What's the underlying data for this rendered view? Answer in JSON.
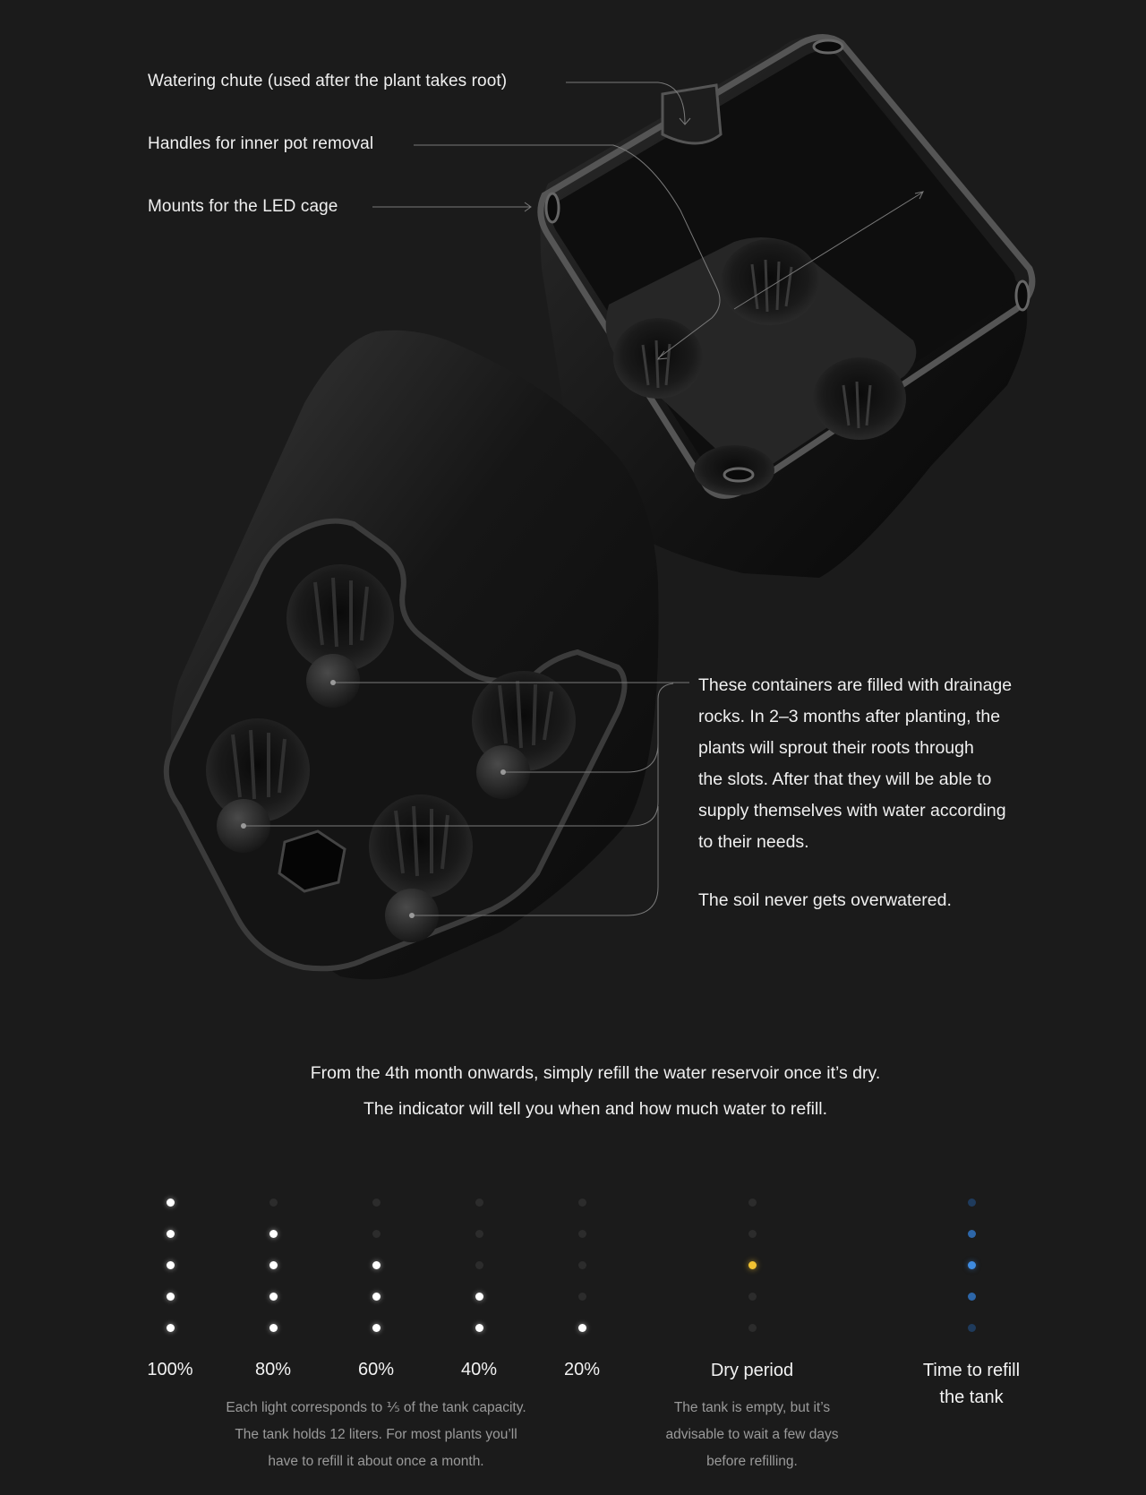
{
  "callouts": {
    "watering_chute": "Watering chute (used after the plant takes root)",
    "handles": "Handles for inner pot removal",
    "mounts": "Mounts for the LED cage"
  },
  "drainage": {
    "paragraph1_lines": [
      "These containers are filled with drainage",
      "rocks. In 2–3 months after planting, the",
      "plants will sprout their roots through",
      "the slots. After that they will be able to",
      "supply themselves with water according",
      "to their needs."
    ],
    "paragraph2": "The soil never gets overwatered."
  },
  "indicator_intro": {
    "line1": "From the 4th month onwards, simply refill the water reservoir once it’s dry.",
    "line2": "The indicator will tell you when and how much water to refill."
  },
  "levels": [
    {
      "label": "100%",
      "lit": 5
    },
    {
      "label": "80%",
      "lit": 4
    },
    {
      "label": "60%",
      "lit": 3
    },
    {
      "label": "40%",
      "lit": 2
    },
    {
      "label": "20%",
      "lit": 1
    }
  ],
  "level_note_lines": [
    "Each light corresponds to ⅕ of the tank capacity.",
    "The tank holds 12 liters. For most plants you’ll",
    "have to refill it about once a month."
  ],
  "dry_period": {
    "label": "Dry period",
    "indicator_color": "#f1c232",
    "note_lines": [
      "The tank is empty, but it’s",
      "advisable to wait a few days",
      "before refilling."
    ]
  },
  "refill": {
    "label_lines": [
      "Time to refill",
      "the tank"
    ],
    "indicator_color": "#3f8be0"
  },
  "colors": {
    "background": "#1b1b1b",
    "text": "#f0f0f0",
    "muted_text": "#9a9a9a"
  }
}
